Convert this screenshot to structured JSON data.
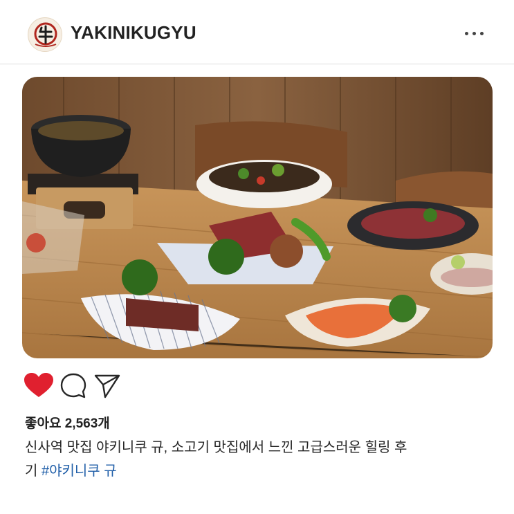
{
  "header": {
    "username": "YAKINIKUGYU",
    "avatar_icon": "yakiniku-gyu-logo-icon",
    "more_icon": "more-options-icon"
  },
  "post": {
    "image_icon": "food-photo",
    "actions": {
      "like_icon": "heart-filled-icon",
      "comment_icon": "comment-bubble-icon",
      "share_icon": "paper-plane-icon",
      "like_color": "#e0202f"
    },
    "likes_text": "좋아요 2,563개",
    "caption_line1": "신사역 맛집 야키니쿠 규, 소고기 맛집에서 느낀 고급스러운 힐링 후",
    "caption_line2_prefix": "기 ",
    "hashtag": "#야키니쿠 규"
  },
  "colors": {
    "accent_link": "#1f5ea8",
    "text": "#262626"
  }
}
